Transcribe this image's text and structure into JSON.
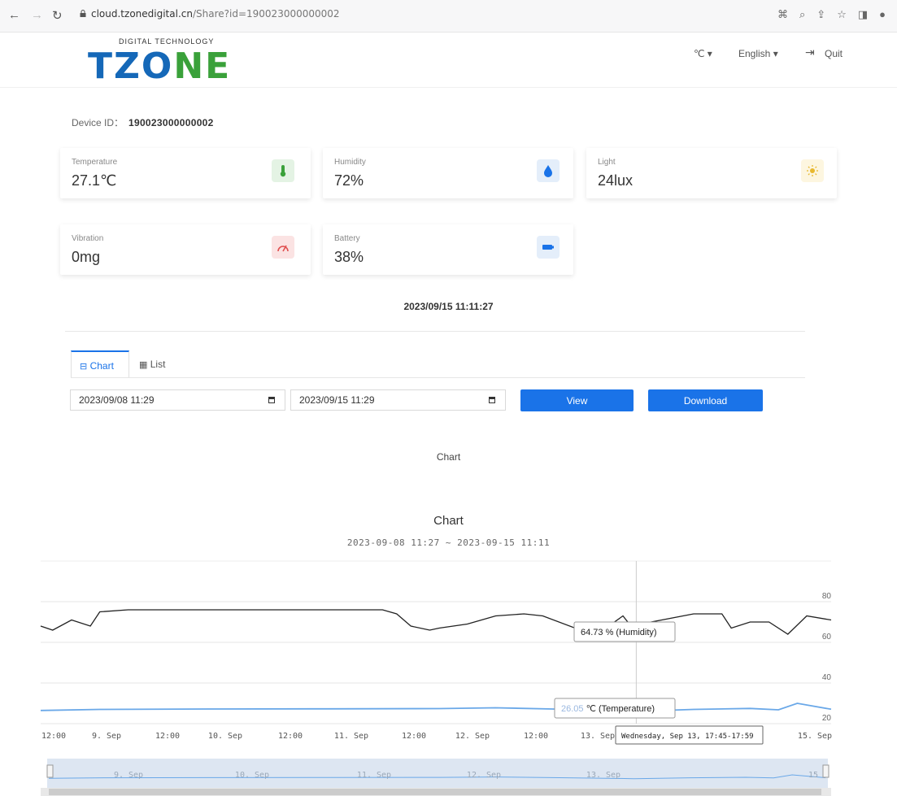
{
  "browser": {
    "url_host": "cloud.tzonedigital.cn",
    "url_path": "/Share?id=190023000000002"
  },
  "header": {
    "logo_tagline": "DIGITAL TECHNOLOGY",
    "logo_text_a": "TZO",
    "logo_text_b": "NE",
    "unit_menu": "℃ ▾",
    "language_menu": "English ▾",
    "quit_label": "Quit"
  },
  "device": {
    "id_label": "Device ID：",
    "id_value": "190023000000002"
  },
  "sensors": [
    {
      "label": "Temperature",
      "value": "27.1℃",
      "icon": "thermometer-icon",
      "icon_bg": "#e4f3e4",
      "icon_color": "#3aa13a"
    },
    {
      "label": "Humidity",
      "value": "72%",
      "icon": "water-drop-icon",
      "icon_bg": "#e4eefa",
      "icon_color": "#1a73e8"
    },
    {
      "label": "Light",
      "value": "24lux",
      "icon": "sun-icon",
      "icon_bg": "#fdf6e0",
      "icon_color": "#e8b830"
    },
    {
      "label": "Vibration",
      "value": "0mg",
      "icon": "gauge-icon",
      "icon_bg": "#fbe3e3",
      "icon_color": "#e05050"
    },
    {
      "label": "Battery",
      "value": "38%",
      "icon": "battery-icon",
      "icon_bg": "#e4eefa",
      "icon_color": "#1a73e8"
    }
  ],
  "timestamp": "2023/09/15 11:11:27",
  "tabs": [
    {
      "label": "Chart",
      "icon": "chart-tab-icon",
      "active": true
    },
    {
      "label": "List",
      "icon": "table-icon",
      "active": false
    }
  ],
  "filters": {
    "start_date": "2023/09/08 11:29",
    "end_date": "2023/09/15 11:29",
    "view_label": "View",
    "download_label": "Download"
  },
  "chart_caption": "Chart",
  "colors": {
    "accent": "#1a73e8",
    "humidity_line": "#222222",
    "temperature_line": "#6aa8e8"
  },
  "chart_data": {
    "type": "line",
    "title": "Chart",
    "subtitle": "2023-09-08 11:27 ~ 2023-09-15 11:11",
    "ylim": [
      20,
      80
    ],
    "yticks": [
      20,
      40,
      60,
      80
    ],
    "x_tick_labels": [
      "12:00",
      "9. Sep",
      "12:00",
      "10. Sep",
      "12:00",
      "11. Sep",
      "12:00",
      "12. Sep",
      "12:00",
      "13. Sep",
      "15. Sep"
    ],
    "navigator_labels": [
      "9. Sep",
      "10. Sep",
      "11. Sep",
      "12. Sep",
      "13. Sep",
      "15"
    ],
    "series": [
      {
        "name": "Humidity",
        "unit": "%",
        "x": [
          "2023-09-08 11:27",
          "2023-09-08 14:00",
          "2023-09-08 18:00",
          "2023-09-08 22:00",
          "2023-09-09 00:00",
          "2023-09-09 06:00",
          "2023-09-09 12:00",
          "2023-09-10 00:00",
          "2023-09-10 12:00",
          "2023-09-11 00:00",
          "2023-09-11 12:00",
          "2023-09-11 15:00",
          "2023-09-11 18:00",
          "2023-09-11 22:00",
          "2023-09-12 00:00",
          "2023-09-12 06:00",
          "2023-09-12 12:00",
          "2023-09-12 18:00",
          "2023-09-12 22:00",
          "2023-09-13 06:00",
          "2023-09-13 12:00",
          "2023-09-13 15:00",
          "2023-09-13 17:50",
          "2023-09-13 21:00",
          "2023-09-14 06:00",
          "2023-09-14 12:00",
          "2023-09-14 14:00",
          "2023-09-14 18:00",
          "2023-09-14 22:00",
          "2023-09-15 02:00",
          "2023-09-15 06:00",
          "2023-09-15 11:11"
        ],
        "values": [
          68,
          66,
          71,
          68,
          75,
          76,
          76,
          76,
          76,
          76,
          76,
          74,
          68,
          66,
          67,
          69,
          73,
          74,
          73,
          66,
          68,
          73,
          64.73,
          70,
          74,
          74,
          67,
          70,
          70,
          64,
          73,
          71
        ]
      },
      {
        "name": "Temperature",
        "unit": "℃",
        "x": [
          "2023-09-08 11:27",
          "2023-09-09 00:00",
          "2023-09-10 00:00",
          "2023-09-11 00:00",
          "2023-09-12 00:00",
          "2023-09-12 12:00",
          "2023-09-13 00:00",
          "2023-09-13 12:00",
          "2023-09-13 17:50",
          "2023-09-14 06:00",
          "2023-09-14 18:00",
          "2023-09-15 00:00",
          "2023-09-15 04:00",
          "2023-09-15 11:11"
        ],
        "values": [
          26.5,
          27,
          27.2,
          27.3,
          27.4,
          27.8,
          27.2,
          26.5,
          26.05,
          27,
          27.5,
          26.8,
          30,
          27.1
        ]
      }
    ],
    "tooltip": {
      "humidity": {
        "value": "64.73",
        "label": "% (Humidity)"
      },
      "temperature": {
        "value": "26.05",
        "label": "℃ (Temperature)"
      },
      "time": "Wednesday, Sep 13, 17:45-17:59"
    },
    "grid": true,
    "legend": "none"
  }
}
